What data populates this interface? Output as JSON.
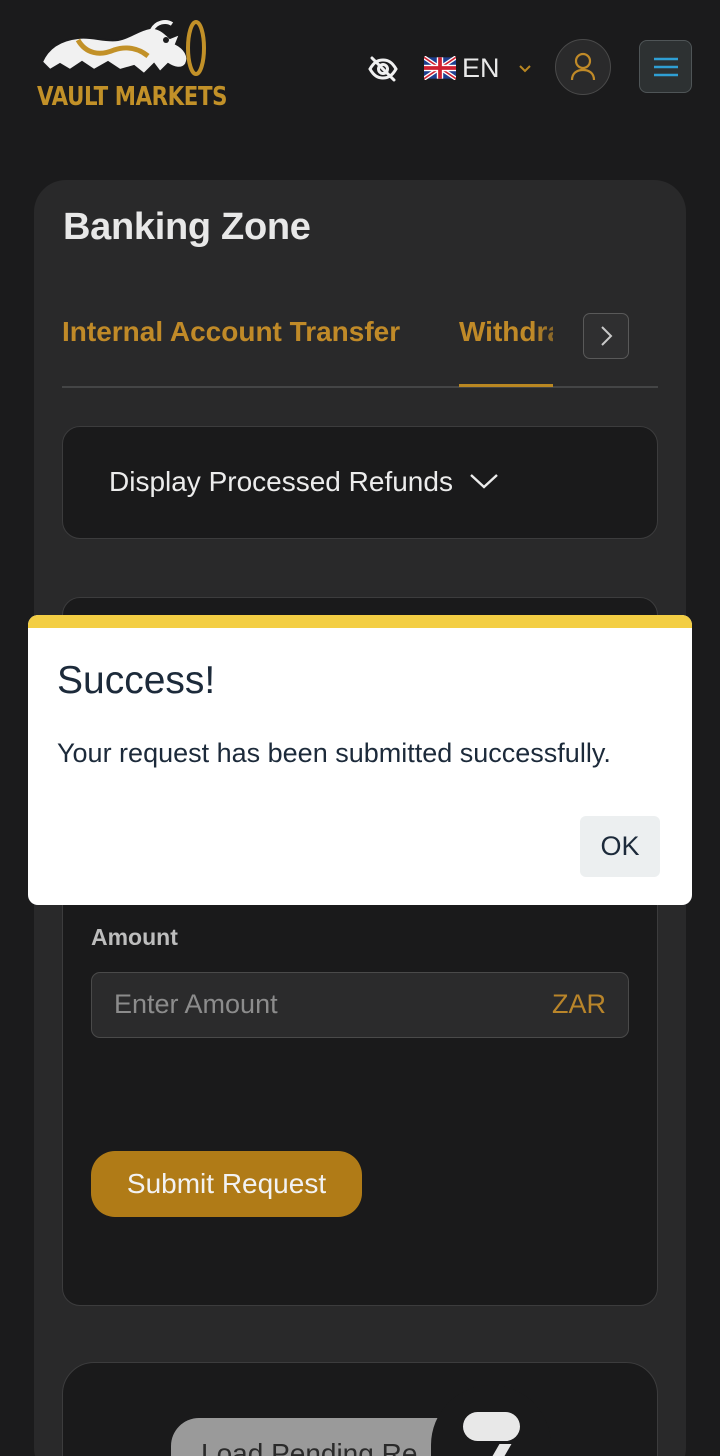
{
  "header": {
    "brand": "VAULT MARKETS",
    "language": "EN",
    "icons": [
      "bull-logo-icon",
      "eye-off-icon",
      "uk-flag-icon",
      "chevron-down-icon",
      "user-icon",
      "hamburger-menu-icon"
    ]
  },
  "banking": {
    "title": "Banking Zone",
    "tabs": [
      {
        "label": "Internal Account Transfer",
        "active": false
      },
      {
        "label": "Withdrawals",
        "active": true
      }
    ],
    "refunds_toggle": "Display Processed Refunds",
    "form": {
      "amount_label": "Amount",
      "amount_placeholder": "Enter Amount",
      "currency": "ZAR",
      "submit_label": "Submit Request"
    },
    "pending_label": "Load Pending Re"
  },
  "modal": {
    "title": "Success!",
    "message": "Your request has been submitted successfully.",
    "ok_label": "OK"
  },
  "colors": {
    "background": "#1b1b1c",
    "card": "#29292a",
    "accent_gold": "#b07b17",
    "modal_bar": "#f3ce44",
    "hamburger": "#2f9fd4"
  }
}
